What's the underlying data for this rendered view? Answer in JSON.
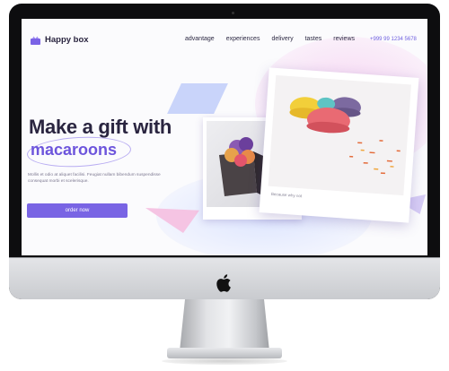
{
  "brand": {
    "name": "Happy box"
  },
  "nav": {
    "items": [
      "advantage",
      "experiences",
      "delivery",
      "tastes",
      "reviews"
    ],
    "phone": "+999 99 1234 5678"
  },
  "hero": {
    "headline": "Make a gift with",
    "highlight": "macaroons",
    "description": "Mollis et odio at aliquet facilisi. Feugiat nullam bibendum suspendisse consequat morbi et scelerisque.",
    "cta_label": "order now",
    "photo_caption": "Because why not"
  },
  "device": {
    "logo_icon": "apple-icon"
  },
  "colors": {
    "accent": "#7964e4",
    "text": "#2a2540",
    "highlight": "#6d55dc"
  }
}
